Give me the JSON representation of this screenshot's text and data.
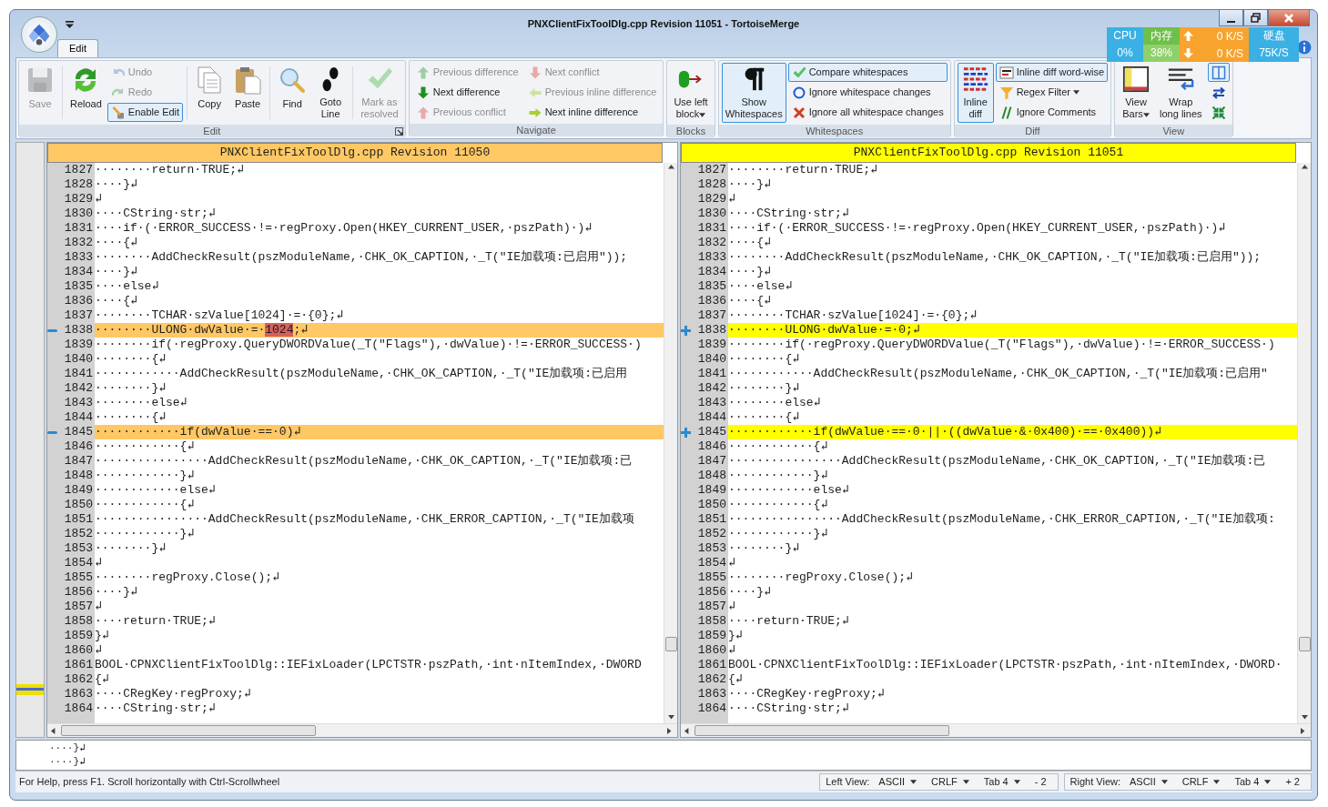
{
  "window": {
    "title": "PNXClientFixToolDlg.cpp Revision 11051 - TortoiseMerge"
  },
  "system_monitor": {
    "cpu_label": "CPU",
    "cpu_value": "0%",
    "memory_label": "内存",
    "memory_value": "38%",
    "upload": "0 K/S",
    "download": "0 K/S",
    "disk_label": "硬盘",
    "disk_value": "75K/S"
  },
  "ribbon": {
    "tabs": [
      {
        "label": "Edit",
        "selected": true
      }
    ],
    "groups": [
      {
        "label": "Edit",
        "launcher": true,
        "items": [
          {
            "kind": "large",
            "label": "Save",
            "disabled": true,
            "checked": false
          },
          {
            "kind": "large",
            "label": "Reload",
            "disabled": false,
            "checked": false
          },
          {
            "kind": "small",
            "label": "Undo",
            "disabled": true,
            "checked": false
          },
          {
            "kind": "small",
            "label": "Redo",
            "disabled": true,
            "checked": false
          },
          {
            "kind": "small",
            "label": "Enable Edit",
            "disabled": false,
            "checked": true
          },
          {
            "kind": "large",
            "label": "Copy",
            "disabled": false,
            "checked": false
          },
          {
            "kind": "large",
            "label": "Paste",
            "disabled": false,
            "checked": false
          },
          {
            "kind": "large",
            "label": "Find",
            "disabled": false,
            "checked": false
          },
          {
            "kind": "large",
            "label": "Goto\nLine",
            "disabled": false,
            "checked": false
          },
          {
            "kind": "large",
            "label": "Mark as\nresolved",
            "disabled": true,
            "checked": false
          }
        ]
      },
      {
        "label": "Navigate",
        "items": [
          {
            "kind": "small",
            "label": "Previous difference",
            "disabled": true,
            "checked": false
          },
          {
            "kind": "small",
            "label": "Next difference",
            "disabled": false,
            "checked": false
          },
          {
            "kind": "small",
            "label": "Previous conflict",
            "disabled": true,
            "checked": false
          },
          {
            "kind": "small",
            "label": "Next conflict",
            "disabled": true,
            "checked": false
          },
          {
            "kind": "small",
            "label": "Previous inline difference",
            "disabled": true,
            "checked": false
          },
          {
            "kind": "small",
            "label": "Next inline difference",
            "disabled": false,
            "checked": false
          }
        ]
      },
      {
        "label": "Blocks",
        "items": [
          {
            "kind": "large",
            "label": "Use left\nblock",
            "dropdown": true,
            "disabled": false,
            "checked": false
          }
        ]
      },
      {
        "label": "Whitespaces",
        "items": [
          {
            "kind": "large",
            "label": "Show\nWhitespaces",
            "disabled": false,
            "checked": true
          },
          {
            "kind": "small",
            "label": "Compare whitespaces",
            "disabled": false,
            "checked": true
          },
          {
            "kind": "small",
            "label": "Ignore whitespace changes",
            "disabled": false,
            "checked": false
          },
          {
            "kind": "small",
            "label": "Ignore all whitespace changes",
            "disabled": false,
            "checked": false
          }
        ]
      },
      {
        "label": "Diff",
        "items": [
          {
            "kind": "large",
            "label": "Inline\ndiff",
            "disabled": false,
            "checked": true
          },
          {
            "kind": "small",
            "label": "Inline diff word-wise",
            "disabled": false,
            "checked": true
          },
          {
            "kind": "small",
            "label": "Regex Filter",
            "dropdown": true,
            "disabled": false,
            "checked": false
          },
          {
            "kind": "small",
            "label": "Ignore Comments",
            "disabled": false,
            "checked": false
          }
        ]
      },
      {
        "label": "View",
        "items": [
          {
            "kind": "large",
            "label": "View\nBars",
            "dropdown": true,
            "disabled": false,
            "checked": false
          },
          {
            "kind": "large",
            "label": "Wrap\nlong lines",
            "disabled": false,
            "checked": false
          },
          {
            "kind": "small",
            "disabled": false,
            "checked": true
          },
          {
            "kind": "small",
            "disabled": false
          },
          {
            "kind": "small",
            "disabled": false
          }
        ]
      }
    ]
  },
  "panes": [
    {
      "title": "PNXClientFixToolDlg.cpp Revision 11050",
      "kind": "left",
      "color": "#ffc864",
      "lines": [
        {
          "num": "1827",
          "text": "········return·TRUE;↲",
          "changed": false
        },
        {
          "num": "1828",
          "text": "····}↲",
          "changed": false
        },
        {
          "num": "1829",
          "text": "↲",
          "changed": false
        },
        {
          "num": "1830",
          "text": "····CString·str;↲",
          "changed": false
        },
        {
          "num": "1831",
          "text": "····if·(·ERROR_SUCCESS·!=·regProxy.Open(HKEY_CURRENT_USER,·pszPath)·)↲",
          "changed": false
        },
        {
          "num": "1832",
          "text": "····{↲",
          "changed": false
        },
        {
          "num": "1833",
          "text": "········AddCheckResult(pszModuleName,·CHK_OK_CAPTION,·_T(\"IE加载项:已启用\"));",
          "changed": false
        },
        {
          "num": "1834",
          "text": "····}↲",
          "changed": false
        },
        {
          "num": "1835",
          "text": "····else↲",
          "changed": false
        },
        {
          "num": "1836",
          "text": "····{↲",
          "changed": false
        },
        {
          "num": "1837",
          "text": "········TCHAR·szValue[1024]·=·{0};↲",
          "changed": false
        },
        {
          "num": "1838",
          "parts": [
            {
              "text": "········ULONG·dwValue·=·"
            },
            {
              "text": "1024",
              "changed": true
            },
            {
              "text": ";↲"
            }
          ],
          "changed": true
        },
        {
          "num": "1839",
          "text": "········if(·regProxy.QueryDWORDValue(_T(\"Flags\"),·dwValue)·!=·ERROR_SUCCESS·)",
          "changed": false
        },
        {
          "num": "1840",
          "text": "········{↲",
          "changed": false
        },
        {
          "num": "1841",
          "text": "············AddCheckResult(pszModuleName,·CHK_OK_CAPTION,·_T(\"IE加载项:已启用",
          "changed": false
        },
        {
          "num": "1842",
          "text": "········}↲",
          "changed": false
        },
        {
          "num": "1843",
          "text": "········else↲",
          "changed": false
        },
        {
          "num": "1844",
          "text": "········{↲",
          "changed": false
        },
        {
          "num": "1845",
          "text": "············if(dwValue·==·0)↲",
          "changed": true
        },
        {
          "num": "1846",
          "text": "············{↲",
          "changed": false
        },
        {
          "num": "1847",
          "text": "················AddCheckResult(pszModuleName,·CHK_OK_CAPTION,·_T(\"IE加载项:已",
          "changed": false
        },
        {
          "num": "1848",
          "text": "············}↲",
          "changed": false
        },
        {
          "num": "1849",
          "text": "············else↲",
          "changed": false
        },
        {
          "num": "1850",
          "text": "············{↲",
          "changed": false
        },
        {
          "num": "1851",
          "text": "················AddCheckResult(pszModuleName,·CHK_ERROR_CAPTION,·_T(\"IE加载项",
          "changed": false
        },
        {
          "num": "1852",
          "text": "············}↲",
          "changed": false
        },
        {
          "num": "1853",
          "text": "········}↲",
          "changed": false
        },
        {
          "num": "1854",
          "text": "↲",
          "changed": false
        },
        {
          "num": "1855",
          "text": "········regProxy.Close();↲",
          "changed": false
        },
        {
          "num": "1856",
          "text": "····}↲",
          "changed": false
        },
        {
          "num": "1857",
          "text": "↲",
          "changed": false
        },
        {
          "num": "1858",
          "text": "····return·TRUE;↲",
          "changed": false
        },
        {
          "num": "1859",
          "text": "}↲",
          "changed": false
        },
        {
          "num": "1860",
          "text": "↲",
          "changed": false
        },
        {
          "num": "1861",
          "text": "BOOL·CPNXClientFixToolDlg::IEFixLoader(LPCTSTR·pszPath,·int·nItemIndex,·DWORD",
          "changed": false
        },
        {
          "num": "1862",
          "text": "{↲",
          "changed": false
        },
        {
          "num": "1863",
          "text": "····CRegKey·regProxy;↲",
          "changed": false
        },
        {
          "num": "1864",
          "text": "····CString·str;↲",
          "changed": false
        }
      ]
    },
    {
      "title": "PNXClientFixToolDlg.cpp Revision 11051",
      "kind": "right",
      "color": "#ffff00",
      "lines": [
        {
          "num": "1827",
          "text": "········return·TRUE;↲",
          "changed": false
        },
        {
          "num": "1828",
          "text": "····}↲",
          "changed": false
        },
        {
          "num": "1829",
          "text": "↲",
          "changed": false
        },
        {
          "num": "1830",
          "text": "····CString·str;↲",
          "changed": false
        },
        {
          "num": "1831",
          "text": "····if·(·ERROR_SUCCESS·!=·regProxy.Open(HKEY_CURRENT_USER,·pszPath)·)↲",
          "changed": false
        },
        {
          "num": "1832",
          "text": "····{↲",
          "changed": false
        },
        {
          "num": "1833",
          "text": "········AddCheckResult(pszModuleName,·CHK_OK_CAPTION,·_T(\"IE加载项:已启用\"));",
          "changed": false
        },
        {
          "num": "1834",
          "text": "····}↲",
          "changed": false
        },
        {
          "num": "1835",
          "text": "····else↲",
          "changed": false
        },
        {
          "num": "1836",
          "text": "····{↲",
          "changed": false
        },
        {
          "num": "1837",
          "text": "········TCHAR·szValue[1024]·=·{0};↲",
          "changed": false
        },
        {
          "num": "1838",
          "text": "········ULONG·dwValue·=·0;↲",
          "changed": true
        },
        {
          "num": "1839",
          "text": "········if(·regProxy.QueryDWORDValue(_T(\"Flags\"),·dwValue)·!=·ERROR_SUCCESS·)",
          "changed": false
        },
        {
          "num": "1840",
          "text": "········{↲",
          "changed": false
        },
        {
          "num": "1841",
          "text": "············AddCheckResult(pszModuleName,·CHK_OK_CAPTION,·_T(\"IE加载项:已启用\"",
          "changed": false
        },
        {
          "num": "1842",
          "text": "········}↲",
          "changed": false
        },
        {
          "num": "1843",
          "text": "········else↲",
          "changed": false
        },
        {
          "num": "1844",
          "text": "········{↲",
          "changed": false
        },
        {
          "num": "1845",
          "text": "············if(dwValue·==·0·||·((dwValue·&·0x400)·==·0x400))↲",
          "changed": true
        },
        {
          "num": "1846",
          "text": "············{↲",
          "changed": false
        },
        {
          "num": "1847",
          "text": "················AddCheckResult(pszModuleName,·CHK_OK_CAPTION,·_T(\"IE加载项:已",
          "changed": false
        },
        {
          "num": "1848",
          "text": "············}↲",
          "changed": false
        },
        {
          "num": "1849",
          "text": "············else↲",
          "changed": false
        },
        {
          "num": "1850",
          "text": "············{↲",
          "changed": false
        },
        {
          "num": "1851",
          "text": "················AddCheckResult(pszModuleName,·CHK_ERROR_CAPTION,·_T(\"IE加载项:",
          "changed": false
        },
        {
          "num": "1852",
          "text": "············}↲",
          "changed": false
        },
        {
          "num": "1853",
          "text": "········}↲",
          "changed": false
        },
        {
          "num": "1854",
          "text": "↲",
          "changed": false
        },
        {
          "num": "1855",
          "text": "········regProxy.Close();↲",
          "changed": false
        },
        {
          "num": "1856",
          "text": "····}↲",
          "changed": false
        },
        {
          "num": "1857",
          "text": "↲",
          "changed": false
        },
        {
          "num": "1858",
          "text": "····return·TRUE;↲",
          "changed": false
        },
        {
          "num": "1859",
          "text": "}↲",
          "changed": false
        },
        {
          "num": "1860",
          "text": "↲",
          "changed": false
        },
        {
          "num": "1861",
          "text": "BOOL·CPNXClientFixToolDlg::IEFixLoader(LPCTSTR·pszPath,·int·nItemIndex,·DWORD·",
          "changed": false
        },
        {
          "num": "1862",
          "text": "{↲",
          "changed": false
        },
        {
          "num": "1863",
          "text": "····CRegKey·regProxy;↲",
          "changed": false
        },
        {
          "num": "1864",
          "text": "····CString·str;↲",
          "changed": false
        }
      ]
    }
  ],
  "bottom_view": {
    "lines": [
      "····}↲",
      "····}↲"
    ]
  },
  "status_bar": {
    "help": "For Help, press F1. Scroll horizontally with Ctrl-Scrollwheel",
    "views": [
      {
        "label": "Left View:",
        "items": [
          {
            "text": "ASCII",
            "dropdown": true
          },
          {
            "text": "CRLF",
            "dropdown": true
          },
          {
            "text": "Tab 4",
            "dropdown": true
          },
          {
            "text": "- 2"
          }
        ]
      },
      {
        "label": "Right View:",
        "items": [
          {
            "text": "ASCII",
            "dropdown": true
          },
          {
            "text": "CRLF",
            "dropdown": true
          },
          {
            "text": "Tab 4",
            "dropdown": true
          },
          {
            "text": "+ 2"
          }
        ]
      }
    ]
  }
}
